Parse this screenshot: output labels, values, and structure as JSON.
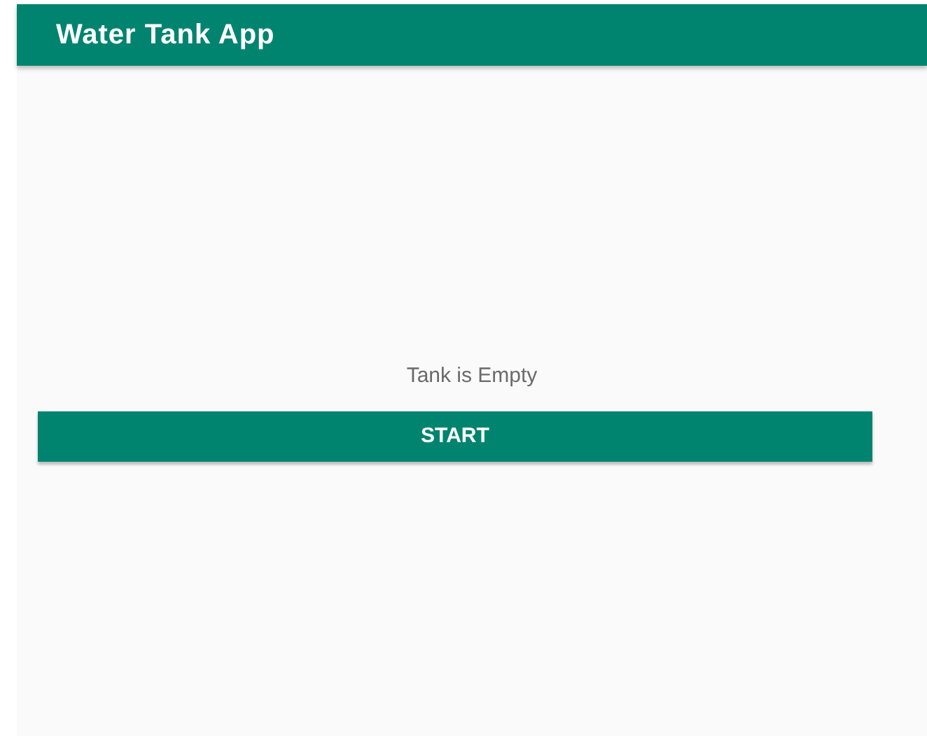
{
  "app_bar": {
    "title": "Water Tank App"
  },
  "status_text": "Tank is Empty",
  "button": {
    "label": "START"
  }
}
